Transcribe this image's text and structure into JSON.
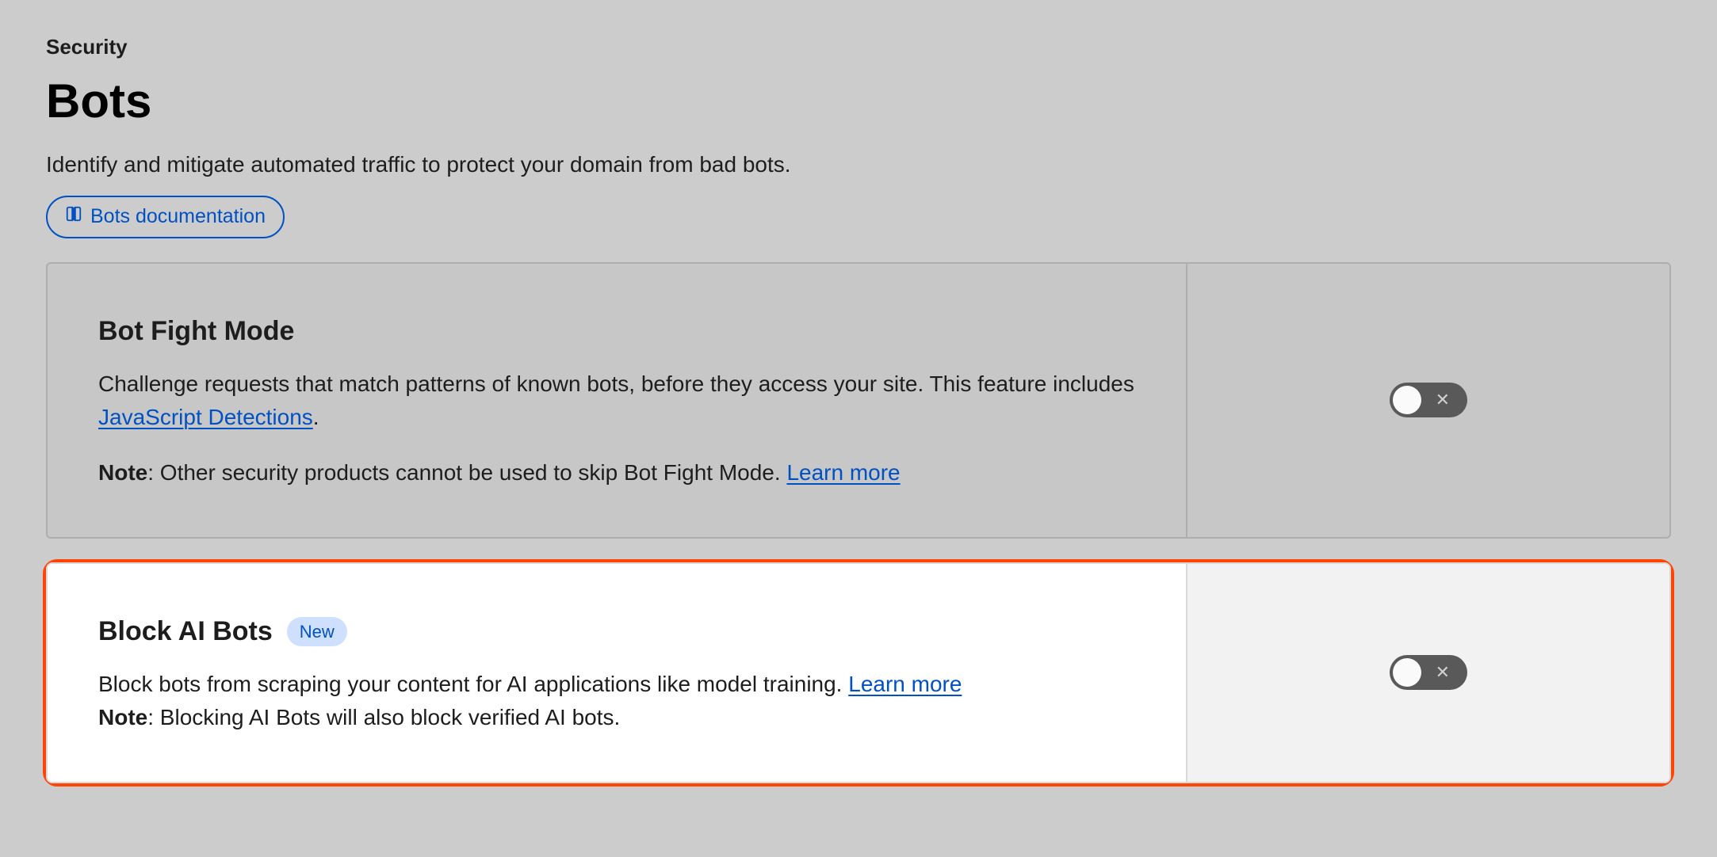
{
  "header": {
    "breadcrumb": "Security",
    "title": "Bots",
    "subtitle": "Identify and mitigate automated traffic to protect your domain from bad bots.",
    "docLink": "Bots documentation"
  },
  "cards": {
    "botFightMode": {
      "title": "Bot Fight Mode",
      "desc_part1": "Challenge requests that match patterns of known bots, before they access your site. This feature includes ",
      "desc_link": "JavaScript Detections",
      "desc_part2": ".",
      "note_label": "Note",
      "note_text": ": Other security products cannot be used to skip Bot Fight Mode. ",
      "note_link": "Learn more",
      "toggle": "off"
    },
    "blockAIBots": {
      "title": "Block AI Bots",
      "badge": "New",
      "desc_part1": "Block bots from scraping your content for AI applications like model training. ",
      "desc_link": "Learn more",
      "note_label": "Note",
      "note_text": ": Blocking AI Bots will also block verified AI bots.",
      "toggle": "off"
    }
  }
}
